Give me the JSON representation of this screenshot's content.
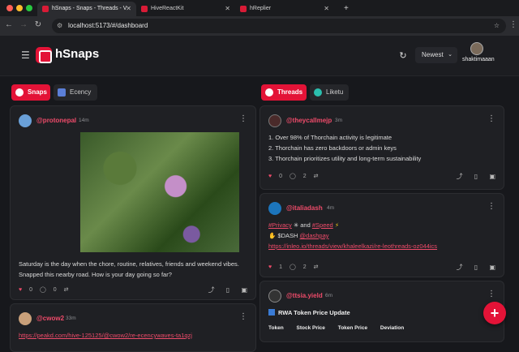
{
  "browser": {
    "tabs": [
      {
        "label": "hSnaps - Snaps - Threads - V"
      },
      {
        "label": "HiveReactKit"
      },
      {
        "label": "hReplier"
      }
    ],
    "url": "localhost:5173/#/dashboard"
  },
  "app": {
    "brand": "hSnaps",
    "sort_value": "Newest",
    "username": "shaktimaaan"
  },
  "left_column": {
    "toggles": [
      {
        "label": "Snaps"
      },
      {
        "label": "Ecency"
      }
    ],
    "posts": [
      {
        "author": "@protonepal",
        "time": "14m",
        "text": "Saturday is the day when the chore, routine, relatives, friends and weekend vibes. Snapped this nearby road. How is your day going so far?",
        "votes": "0",
        "comments": "0"
      },
      {
        "author": "@cwow2",
        "time": "33m",
        "link": "https://peakd.com/hive-125125/@cwow2/re-ecencywaves-ta1qzj"
      }
    ]
  },
  "right_column": {
    "toggles": [
      {
        "label": "Threads"
      },
      {
        "label": "Liketu"
      }
    ],
    "posts": [
      {
        "author": "@theycallmejp",
        "time": "3m",
        "lines": [
          "1. Over 98% of Thorchain activity is legitimate",
          "2. Thorchain has zero backdoors or admin keys",
          "3. Thorchain prioritizes utility and long-term sustainability"
        ],
        "votes": "0",
        "comments": "2"
      },
      {
        "author": "@italiadash",
        "time": "4m",
        "tags": [
          "#Privacy",
          "#Speed"
        ],
        "tag_sep": "and",
        "line2": "$DASH",
        "mention": "@dashpay",
        "link": "https://inleo.io/threads/view/khaleelkazi/re-leothreads-oz044ics",
        "votes": "1",
        "comments": "2"
      },
      {
        "author": "@ttsia.yield",
        "time": "6m",
        "title": "RWA Token Price Update",
        "table_headers": [
          "Token",
          "Stock Price",
          "Token Price",
          "Deviation"
        ]
      }
    ]
  },
  "colors": {
    "accent": "#e31337",
    "link": "#ef4b6a"
  }
}
